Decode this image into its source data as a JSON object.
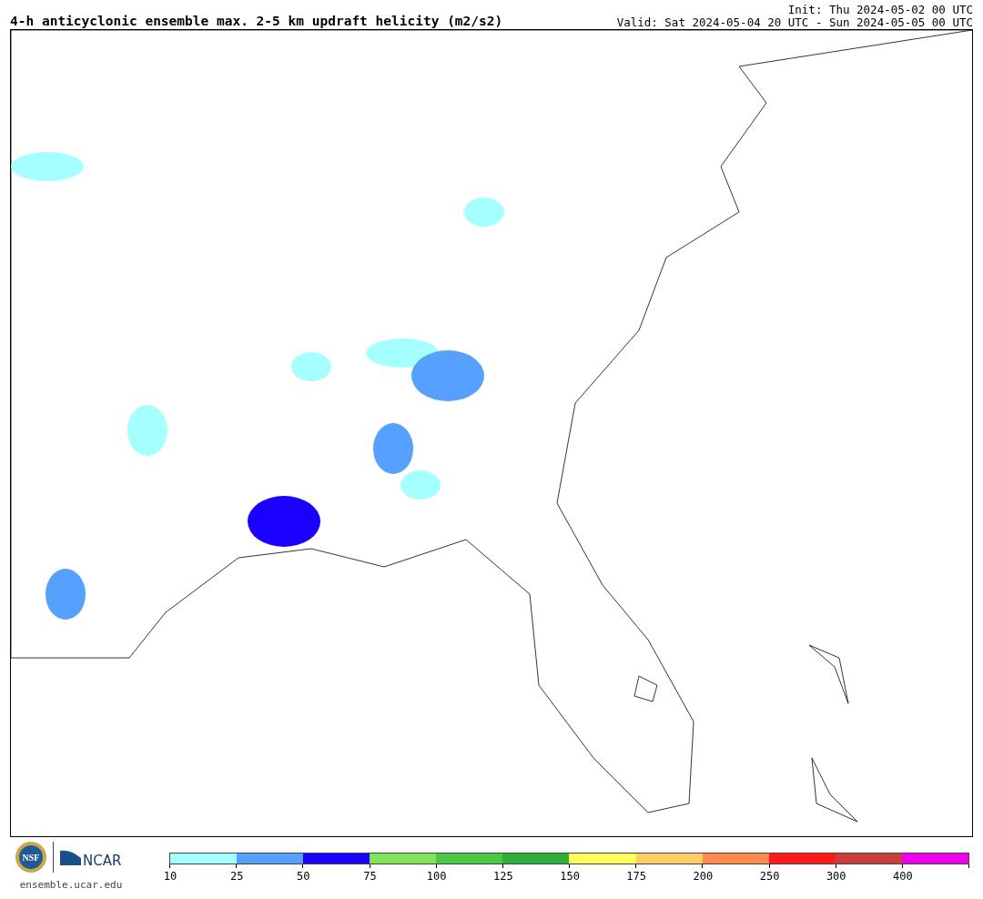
{
  "title": "4-h anticyclonic ensemble max. 2-5 km updraft helicity (m2/s2)",
  "init": "Init: Thu 2024-05-02 00 UTC",
  "valid": "Valid: Sat 2024-05-04 20 UTC - Sun 2024-05-05 00 UTC",
  "logos": {
    "nsf": "NSF",
    "ncar": "NCAR",
    "url": "ensemble.ucar.edu"
  },
  "colorbar": [
    {
      "label": "10",
      "color": "#a6ffff"
    },
    {
      "label": "25",
      "color": "#56a0ff"
    },
    {
      "label": "50",
      "color": "#1a00ff"
    },
    {
      "label": "75",
      "color": "#80e45a"
    },
    {
      "label": "100",
      "color": "#4cc944"
    },
    {
      "label": "125",
      "color": "#2eae36"
    },
    {
      "label": "150",
      "color": "#ffff5c"
    },
    {
      "label": "175",
      "color": "#ffcc66"
    },
    {
      "label": "200",
      "color": "#ff8a4c"
    },
    {
      "label": "250",
      "color": "#ff1a1a"
    },
    {
      "label": "300",
      "color": "#cc3d3d"
    },
    {
      "label": "400",
      "color": "#ee00ee"
    }
  ]
}
